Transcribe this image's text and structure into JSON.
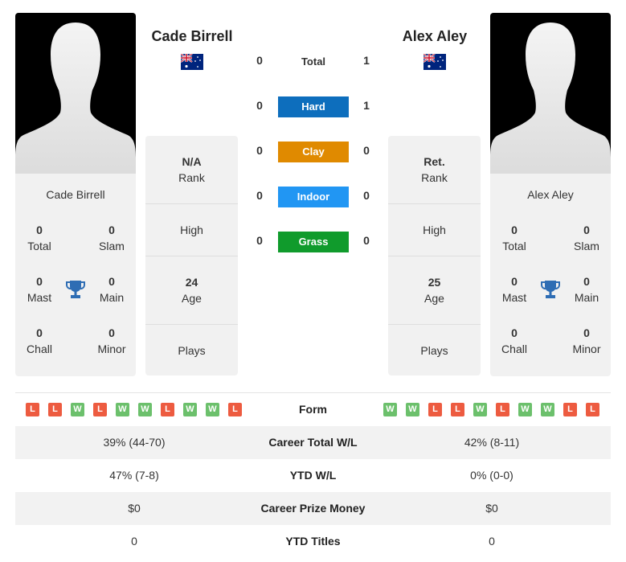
{
  "colors": {
    "hard": "#0d6ebd",
    "clay": "#e08a00",
    "indoor": "#2196f3",
    "grass": "#109b2c",
    "win": "#6cc06c",
    "loss": "#ed5b40",
    "trophy": "#2e6db4"
  },
  "player1": {
    "name": "Cade Birrell",
    "flag": "australia-flag",
    "card_name": "Cade Birrell",
    "stats": {
      "total": {
        "value": "0",
        "label": "Total"
      },
      "slam": {
        "value": "0",
        "label": "Slam"
      },
      "mast": {
        "value": "0",
        "label": "Mast"
      },
      "main": {
        "value": "0",
        "label": "Main"
      },
      "chall": {
        "value": "0",
        "label": "Chall"
      },
      "minor": {
        "value": "0",
        "label": "Minor"
      }
    },
    "info": {
      "rank_value": "N/A",
      "rank_label": "Rank",
      "high_label": "High",
      "age_value": "24",
      "age_label": "Age",
      "plays_label": "Plays"
    },
    "form": [
      "L",
      "L",
      "W",
      "L",
      "W",
      "W",
      "L",
      "W",
      "W",
      "L"
    ]
  },
  "player2": {
    "name": "Alex Aley",
    "flag": "australia-flag",
    "card_name": "Alex Aley",
    "stats": {
      "total": {
        "value": "0",
        "label": "Total"
      },
      "slam": {
        "value": "0",
        "label": "Slam"
      },
      "mast": {
        "value": "0",
        "label": "Mast"
      },
      "main": {
        "value": "0",
        "label": "Main"
      },
      "chall": {
        "value": "0",
        "label": "Chall"
      },
      "minor": {
        "value": "0",
        "label": "Minor"
      }
    },
    "info": {
      "rank_value": "Ret.",
      "rank_label": "Rank",
      "high_label": "High",
      "age_value": "25",
      "age_label": "Age",
      "plays_label": "Plays"
    },
    "form": [
      "W",
      "W",
      "L",
      "L",
      "W",
      "L",
      "W",
      "W",
      "L",
      "L"
    ]
  },
  "h2h": {
    "total": {
      "label": "Total",
      "p1": "0",
      "p2": "1"
    },
    "surfaces": [
      {
        "label": "Hard",
        "p1": "0",
        "p2": "1",
        "key": "hard"
      },
      {
        "label": "Clay",
        "p1": "0",
        "p2": "0",
        "key": "clay"
      },
      {
        "label": "Indoor",
        "p1": "0",
        "p2": "0",
        "key": "indoor"
      },
      {
        "label": "Grass",
        "p1": "0",
        "p2": "0",
        "key": "grass"
      }
    ]
  },
  "table": {
    "form_label": "Form",
    "rows": [
      {
        "label": "Career Total W/L",
        "p1": "39% (44-70)",
        "p2": "42% (8-11)"
      },
      {
        "label": "YTD W/L",
        "p1": "47% (7-8)",
        "p2": "0% (0-0)"
      },
      {
        "label": "Career Prize Money",
        "p1": "$0",
        "p2": "$0"
      },
      {
        "label": "YTD Titles",
        "p1": "0",
        "p2": "0"
      }
    ]
  }
}
